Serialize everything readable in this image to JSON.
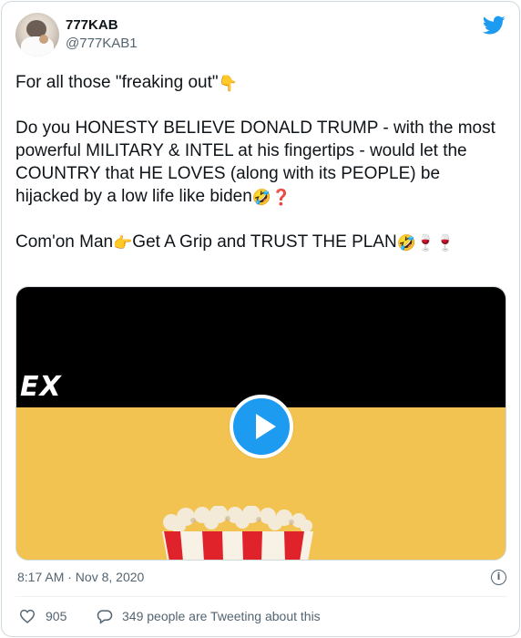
{
  "author": {
    "display_name": "777KAB",
    "handle": "@777KAB1"
  },
  "tweet": {
    "paragraphs": [
      {
        "parts": [
          {
            "text": "For all those \"freaking out\""
          },
          {
            "emoji": "👇"
          }
        ]
      },
      {
        "parts": [
          {
            "text": "Do you HONESTY BELIEVE DONALD TRUMP - with the most powerful MILITARY & INTEL at his fingertips - would let the COUNTRY that HE LOVES (along with its PEOPLE) be hijacked by a low life like biden"
          },
          {
            "emoji": "🤣"
          },
          {
            "emoji": "❓"
          }
        ]
      },
      {
        "parts": [
          {
            "text": "Com'on Man"
          },
          {
            "emoji": "👉"
          },
          {
            "text": "Get A Grip and TRUST THE PLAN"
          },
          {
            "emoji": "🤣"
          },
          {
            "emoji": "🍷"
          },
          {
            "emoji": "🍷"
          }
        ]
      }
    ]
  },
  "media": {
    "overlay_text": "EX",
    "play_icon": "play-icon",
    "colors": {
      "top": "#000000",
      "bottom": "#f3c352",
      "play": "#1d9bf0"
    }
  },
  "meta": {
    "timestamp": "8:17 AM · Nov 8, 2020",
    "info_icon": "info-icon",
    "info_glyph": "i"
  },
  "actions": {
    "like_count": "905",
    "talking_text": "349 people are Tweeting about this"
  },
  "icons": {
    "brand": "twitter-bird-icon",
    "like": "heart-icon",
    "reply": "reply-bubble-icon"
  }
}
